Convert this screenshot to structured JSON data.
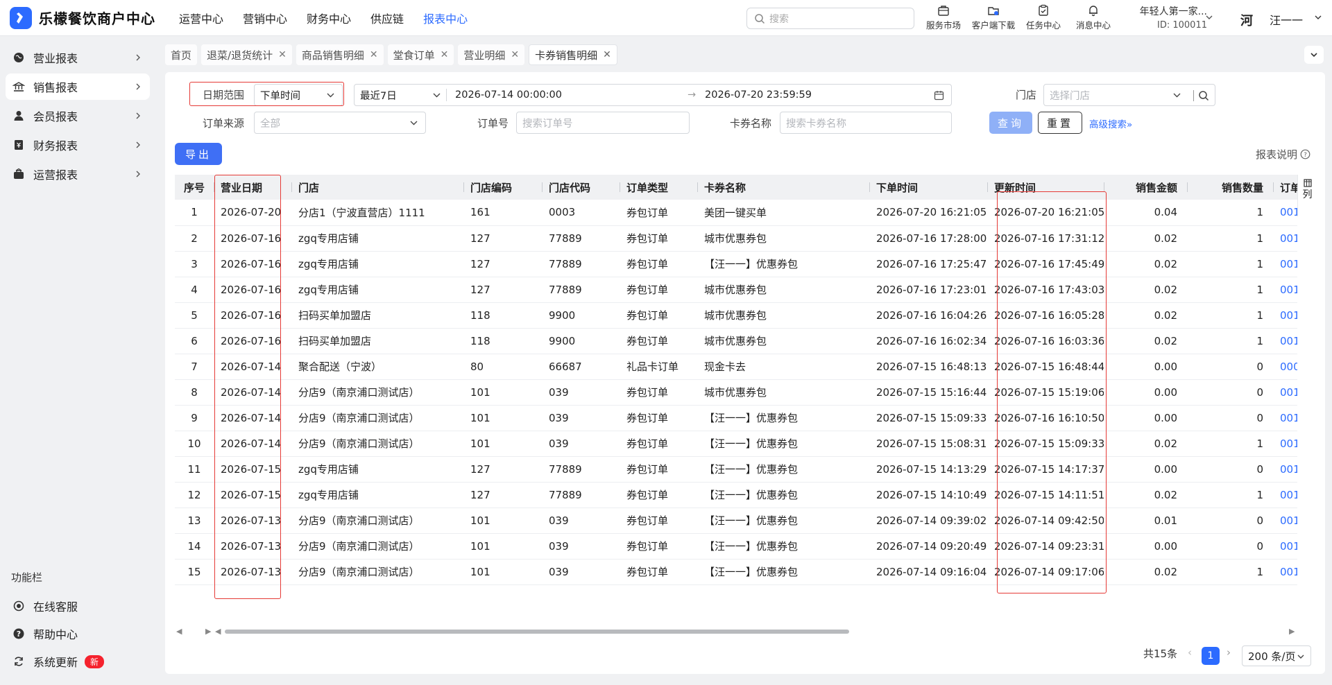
{
  "app": {
    "title": "乐檬餐饮商户中心",
    "nav": [
      "运营中心",
      "营销中心",
      "财务中心",
      "供应链",
      "报表中心"
    ],
    "nav_active": 4,
    "search_placeholder": "搜索",
    "top_icons": [
      {
        "icon": "shop-icon",
        "label": "服务市场"
      },
      {
        "icon": "download-icon",
        "label": "客户端下载"
      },
      {
        "icon": "task-icon",
        "label": "任务中心"
      },
      {
        "icon": "bell-icon",
        "label": "消息中心"
      }
    ],
    "account_name": "年轻人第一家...",
    "account_id": "ID: 100011",
    "user_avatar_text": "河",
    "user_name": "汪一一"
  },
  "sidebar": {
    "items": [
      {
        "label": "营业报表",
        "icon": "globe-icon"
      },
      {
        "label": "销售报表",
        "icon": "bank-icon"
      },
      {
        "label": "会员报表",
        "icon": "user-icon"
      },
      {
        "label": "财务报表",
        "icon": "ledger-icon"
      },
      {
        "label": "运营报表",
        "icon": "briefcase-icon"
      }
    ],
    "active_index": 1,
    "func_title": "功能栏",
    "func_items": [
      {
        "label": "在线客服",
        "icon": "headset-icon"
      },
      {
        "label": "帮助中心",
        "icon": "help-icon"
      },
      {
        "label": "系统更新",
        "icon": "refresh-icon",
        "badge": "新"
      }
    ]
  },
  "tabs": [
    {
      "label": "首页",
      "closable": false
    },
    {
      "label": "退菜/退货统计",
      "closable": true
    },
    {
      "label": "商品销售明细",
      "closable": true
    },
    {
      "label": "堂食订单",
      "closable": true
    },
    {
      "label": "营业明细",
      "closable": true
    },
    {
      "label": "卡券销售明细",
      "closable": true
    }
  ],
  "tab_close_symbol": "✕",
  "tab_active_index": 5,
  "filters": {
    "date_range_label": "日期范围",
    "date_type": "下单时间",
    "date_preset": "最近7日",
    "date_start": "2026-07-14 00:00:00",
    "date_arrow": "→",
    "date_end": "2026-07-20 23:59:59",
    "store_label": "门店",
    "store_placeholder": "选择门店",
    "source_label": "订单来源",
    "source_value": "全部",
    "order_no_label": "订单号",
    "order_no_placeholder": "搜索订单号",
    "card_name_label": "卡券名称",
    "card_name_placeholder": "搜索卡券名称",
    "query_button": "查询",
    "reset_button": "重置",
    "advanced_search": "高级搜索",
    "export_button": "导出",
    "report_note": "报表说明"
  },
  "table": {
    "columns": [
      "序号",
      "营业日期",
      "门店",
      "门店编码",
      "门店代码",
      "订单类型",
      "卡券名称",
      "下单时间",
      "更新时间",
      "销售金额",
      "销售数量",
      "订单"
    ],
    "column_setting": "列",
    "rows": [
      [
        "1",
        "2026-07-20",
        "分店1（宁波直营店）1111",
        "161",
        "0003",
        "券包订单",
        "美团一键买单",
        "2026-07-20 16:21:05",
        "2026-07-20 16:21:05",
        "0.04",
        "1",
        "001"
      ],
      [
        "2",
        "2026-07-16",
        "zgq专用店铺",
        "127",
        "77889",
        "券包订单",
        "城市优惠券包",
        "2026-07-16 17:28:00",
        "2026-07-16 17:31:12",
        "0.02",
        "1",
        "001"
      ],
      [
        "3",
        "2026-07-16",
        "zgq专用店铺",
        "127",
        "77889",
        "券包订单",
        "【汪一一】优惠券包",
        "2026-07-16 17:25:47",
        "2026-07-16 17:45:49",
        "0.02",
        "1",
        "001"
      ],
      [
        "4",
        "2026-07-16",
        "zgq专用店铺",
        "127",
        "77889",
        "券包订单",
        "城市优惠券包",
        "2026-07-16 17:23:01",
        "2026-07-16 17:43:03",
        "0.02",
        "1",
        "001"
      ],
      [
        "5",
        "2026-07-16",
        "扫码买单加盟店",
        "118",
        "9900",
        "券包订单",
        "城市优惠券包",
        "2026-07-16 16:04:26",
        "2026-07-16 16:05:28",
        "0.02",
        "1",
        "001"
      ],
      [
        "6",
        "2026-07-16",
        "扫码买单加盟店",
        "118",
        "9900",
        "券包订单",
        "城市优惠券包",
        "2026-07-16 16:02:34",
        "2026-07-16 16:03:36",
        "0.02",
        "1",
        "001"
      ],
      [
        "7",
        "2026-07-14",
        "聚合配送（宁波）",
        "80",
        "66687",
        "礼品卡订单",
        "现金卡去",
        "2026-07-15 16:48:13",
        "2026-07-15 16:48:44",
        "0.00",
        "0",
        "000"
      ],
      [
        "8",
        "2026-07-14",
        "分店9（南京浦口测试店）",
        "101",
        "039",
        "券包订单",
        "城市优惠券包",
        "2026-07-15 15:16:44",
        "2026-07-15 15:19:06",
        "0.00",
        "0",
        "001"
      ],
      [
        "9",
        "2026-07-14",
        "分店9（南京浦口测试店）",
        "101",
        "039",
        "券包订单",
        "【汪一一】优惠券包",
        "2026-07-15 15:09:33",
        "2026-07-16 16:10:50",
        "0.00",
        "0",
        "001"
      ],
      [
        "10",
        "2026-07-14",
        "分店9（南京浦口测试店）",
        "101",
        "039",
        "券包订单",
        "【汪一一】优惠券包",
        "2026-07-15 15:08:31",
        "2026-07-15 15:09:33",
        "0.02",
        "1",
        "001"
      ],
      [
        "11",
        "2026-07-15",
        "zgq专用店铺",
        "127",
        "77889",
        "券包订单",
        "【汪一一】优惠券包",
        "2026-07-15 14:13:29",
        "2026-07-15 14:17:37",
        "0.00",
        "0",
        "001"
      ],
      [
        "12",
        "2026-07-15",
        "zgq专用店铺",
        "127",
        "77889",
        "券包订单",
        "【汪一一】优惠券包",
        "2026-07-15 14:10:49",
        "2026-07-15 14:11:51",
        "0.02",
        "1",
        "001"
      ],
      [
        "13",
        "2026-07-13",
        "分店9（南京浦口测试店）",
        "101",
        "039",
        "券包订单",
        "【汪一一】优惠券包",
        "2026-07-14 09:39:02",
        "2026-07-14 09:42:50",
        "0.01",
        "0",
        "001"
      ],
      [
        "14",
        "2026-07-13",
        "分店9（南京浦口测试店）",
        "101",
        "039",
        "券包订单",
        "【汪一一】优惠券包",
        "2026-07-14 09:20:49",
        "2026-07-14 09:23:31",
        "0.00",
        "0",
        "001"
      ],
      [
        "15",
        "2026-07-13",
        "分店9（南京浦口测试店）",
        "101",
        "039",
        "券包订单",
        "【汪一一】优惠券包",
        "2026-07-14 09:16:04",
        "2026-07-14 09:17:06",
        "0.02",
        "1",
        "001"
      ]
    ]
  },
  "pagination": {
    "total": "共15条",
    "current_page": "1",
    "page_size": "200 条/页"
  },
  "colors": {
    "accent": "#2c6bff",
    "highlight_border": "#e53935",
    "badge": "#f5222d"
  }
}
